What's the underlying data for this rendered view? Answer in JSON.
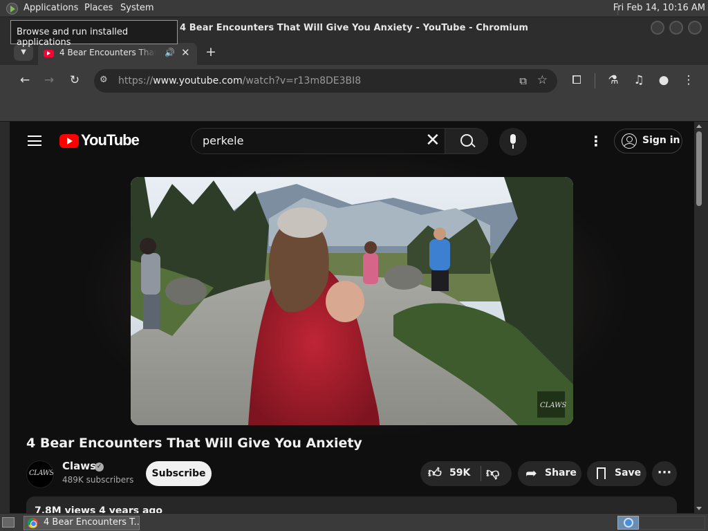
{
  "panel": {
    "applications": "Applications",
    "places": "Places",
    "system": "System",
    "clock": "Fri Feb 14, 10:16 AM",
    "tooltip": "Browse and run installed applications"
  },
  "window": {
    "title": "4 Bear Encounters That Will Give You Anxiety - YouTube - Chromium"
  },
  "tabs": {
    "active_title": "4 Bear Encounters That Will Give You Anxiety - YouTube",
    "new_tab_symbol": "+",
    "close_symbol": "✕",
    "audio_symbol": "🔊"
  },
  "toolbar": {
    "url_scheme": "https://",
    "url_host": "www.youtube.com",
    "url_path": "/watch?v=r13m8DE3BI8"
  },
  "youtube": {
    "logo_text": "YouTube",
    "search_value": "perkele",
    "sign_in": "Sign in",
    "video": {
      "title": "4 Bear Encounters That Will Give You Anxiety",
      "watermark": "CLAWS"
    },
    "channel": {
      "name": "Claws",
      "avatar_text": "CLAWS",
      "subscribers": "489K subscribers",
      "subscribe": "Subscribe"
    },
    "actions": {
      "likes": "59K",
      "share": "Share",
      "save": "Save"
    },
    "description": {
      "meta": "7.8M views  4 years ago"
    }
  },
  "taskbar": {
    "task_title": "4 Bear Encounters T..."
  },
  "colors": {
    "yt_red": "#ff0000",
    "yt_background": "#0f0f0f",
    "pill": "#272727",
    "subscribe_bg": "#f1f1f1"
  }
}
